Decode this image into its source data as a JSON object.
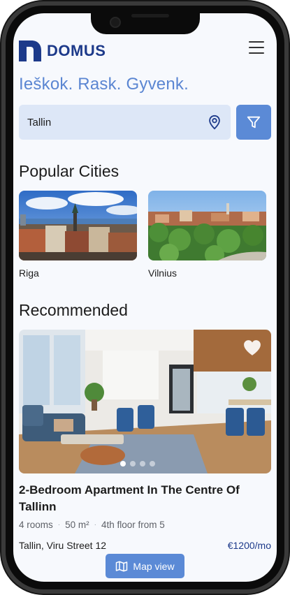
{
  "brand": {
    "name": "DOMUS",
    "color": "#1d3a8a",
    "accent": "#5b8ad6"
  },
  "tagline": "Ieškok. Rask. Gyvenk.",
  "search": {
    "value": "Tallin",
    "placeholder": ""
  },
  "icons": [
    "logo-mark",
    "menu-icon",
    "location-pin-icon",
    "filter-icon",
    "heart-icon",
    "map-icon"
  ],
  "popular": {
    "heading": "Popular Cities",
    "cities": [
      {
        "name": "Riga"
      },
      {
        "name": "Vilnius"
      }
    ]
  },
  "recommended": {
    "heading": "Recommended",
    "listing": {
      "title": "2-Bedroom Apartment In The Centre Of Tallinn",
      "rooms": "4 rooms",
      "area": "50 m²",
      "floor": "4th floor from 5",
      "address": "Tallin, Viru Street  12",
      "price": "€1200/mo",
      "gallery_count": 4,
      "active_photo": 1
    }
  },
  "map_button": {
    "label": "Map view"
  }
}
